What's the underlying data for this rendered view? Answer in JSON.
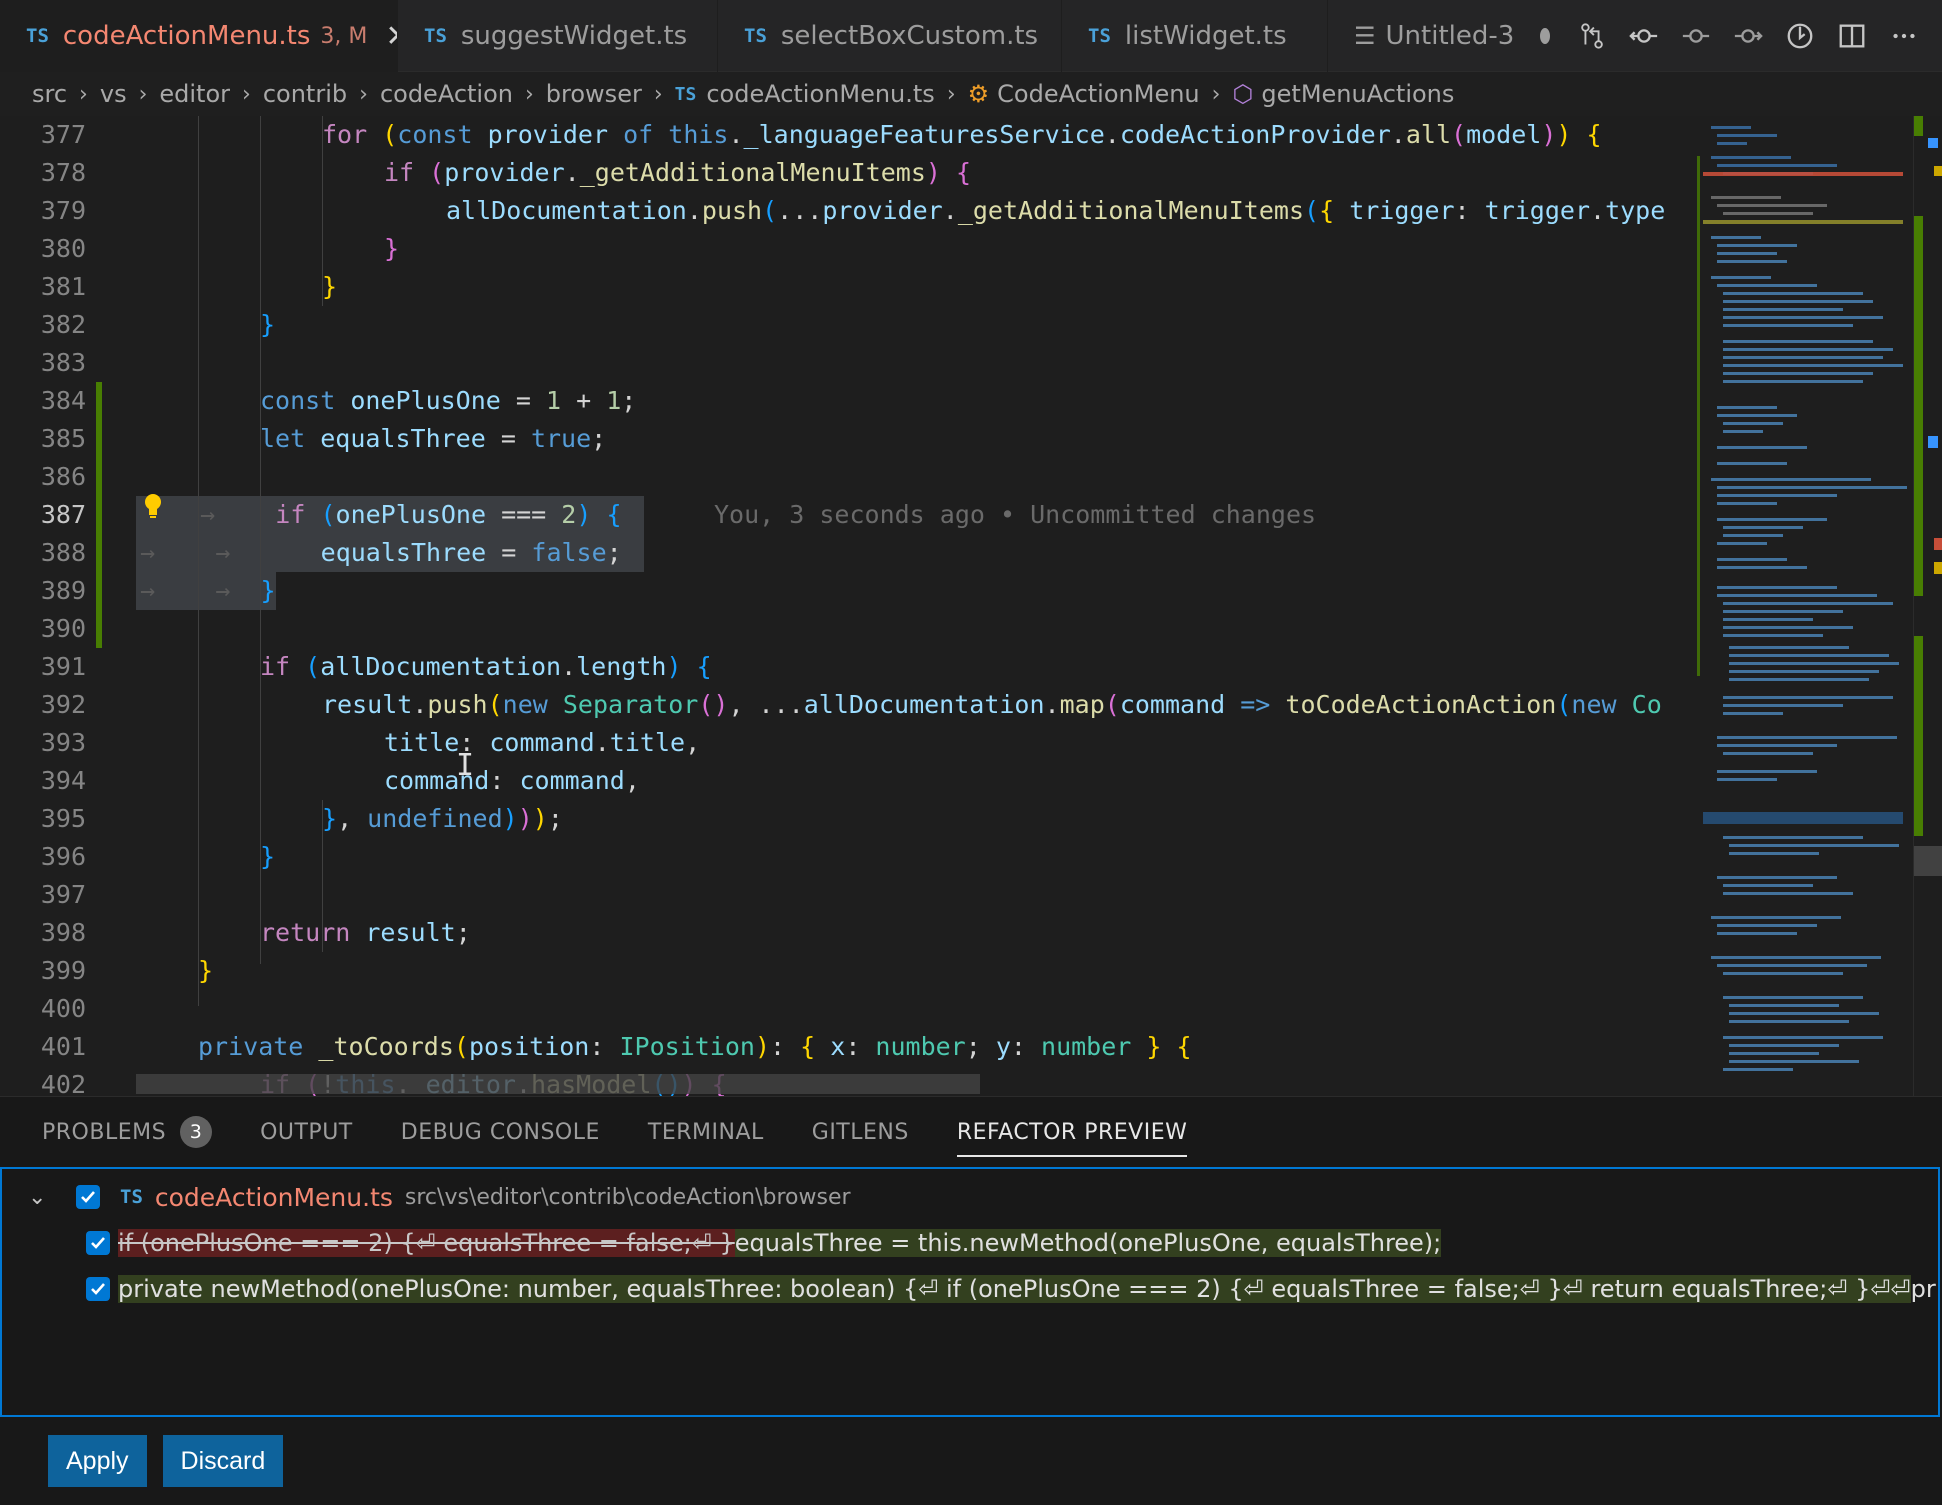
{
  "tabs": [
    {
      "lang": "TS",
      "label": "codeActionMenu.ts",
      "status": "3, M",
      "active": true
    },
    {
      "lang": "TS",
      "label": "suggestWidget.ts"
    },
    {
      "lang": "TS",
      "label": "selectBoxCustom.ts"
    },
    {
      "lang": "TS",
      "label": "listWidget.ts"
    },
    {
      "label": "Untitled-3"
    }
  ],
  "breadcrumb": {
    "items": [
      "src",
      "vs",
      "editor",
      "contrib",
      "codeAction",
      "browser"
    ],
    "file_lang": "TS",
    "file": "codeActionMenu.ts",
    "class": "CodeActionMenu",
    "method": "getMenuActions"
  },
  "editor": {
    "line_numbers": [
      "377",
      "378",
      "379",
      "380",
      "381",
      "382",
      "383",
      "384",
      "385",
      "386",
      "387",
      "388",
      "389",
      "390",
      "391",
      "392",
      "393",
      "394",
      "395",
      "396",
      "397",
      "398",
      "399",
      "400",
      "401",
      "402"
    ],
    "blame": "You, 3 seconds ago • Uncommitted changes"
  },
  "panel": {
    "tabs": [
      {
        "label": "PROBLEMS",
        "count": "3"
      },
      {
        "label": "OUTPUT"
      },
      {
        "label": "DEBUG CONSOLE"
      },
      {
        "label": "TERMINAL"
      },
      {
        "label": "GITLENS"
      },
      {
        "label": "REFACTOR PREVIEW",
        "active": true
      }
    ],
    "refactor": {
      "file_lang": "TS",
      "file": "codeActionMenu.ts",
      "path": "src\\vs\\editor\\contrib\\codeAction\\browser",
      "change1_deleted": "if (onePlusOne === 2) {⏎ equalsThree = false;⏎ }",
      "change1_inserted": "equalsThree = this.newMethod(onePlusOne, equalsThree);",
      "change2_inserted": "private newMethod(onePlusOne: number, equalsThree: boolean) {⏎ if (onePlusOne === 2) {⏎ equalsThree = false;⏎ }⏎ return equalsThree;⏎ }⏎⏎",
      "change2_rest": " private _toCoords(position: IPosition): { x: number; y: number } {"
    },
    "apply_label": "Apply",
    "discard_label": "Discard"
  }
}
